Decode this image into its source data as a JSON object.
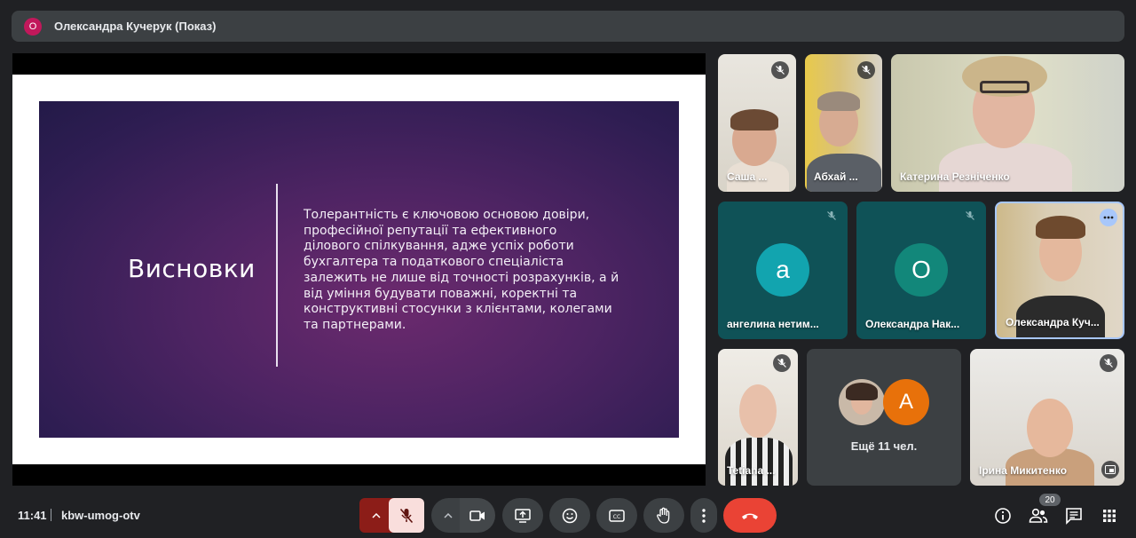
{
  "presenter_bar": {
    "avatar_letter": "О",
    "title": "Олександра Кучерук (Показ)"
  },
  "slide": {
    "title": "Висновки",
    "body_lines": [
      "Толерантність є ключовою основою довіри,",
      "професійної репутації та ефективного",
      "ділового спілкування, адже успіх роботи",
      "бухгалтера та податкового спеціаліста",
      "залежить не лише від точності розрахунків, а й",
      "від уміння будувати поважні, коректні та",
      "конструктивні стосунки з клієнтами, колегами",
      "та партнерами."
    ]
  },
  "participants": [
    {
      "name": "Саша ..."
    },
    {
      "name": "Абхай ..."
    },
    {
      "name": "Катерина Резніченко"
    },
    {
      "name": "ангелина нетим...",
      "avatar": "а"
    },
    {
      "name": "Олександра Нак...",
      "avatar": "О"
    },
    {
      "name": "Олександра Куч..."
    },
    {
      "name": "Tetiana ..."
    },
    {
      "name": "Ірина Микитенко"
    }
  ],
  "more_tile": {
    "avatar_letter": "A",
    "label": "Ещё 11 чел."
  },
  "bottom": {
    "time": "11:41",
    "meeting_code": "kbw-umog-otv",
    "participants_count": "20"
  },
  "colors": {
    "accent_red": "#ea4335",
    "mic_off_bg": "#f9dedc",
    "tile_teal": "#0f5257",
    "avatar_teal": "#12a4af",
    "avatar_green": "#12877a",
    "avatar_orange": "#e8710a"
  }
}
